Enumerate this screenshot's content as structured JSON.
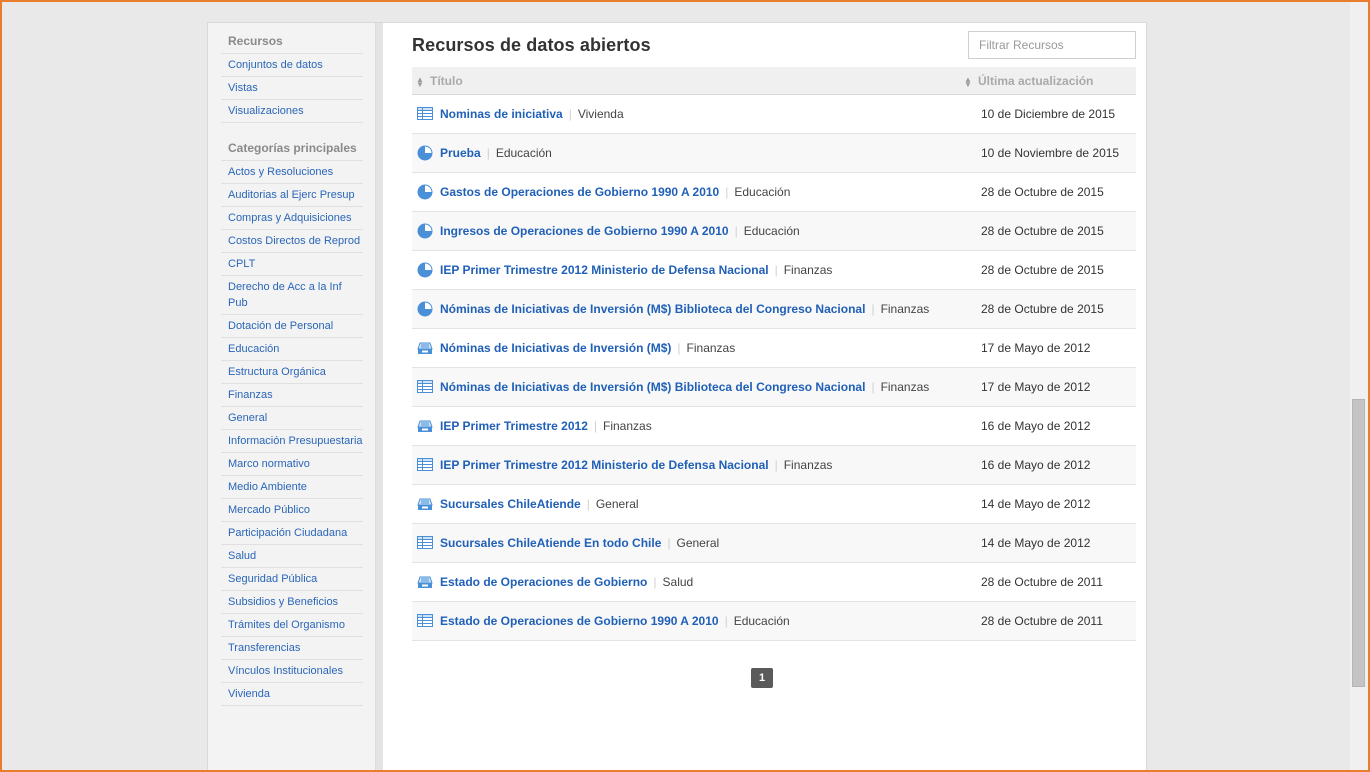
{
  "sidebar": {
    "resources_heading": "Recursos",
    "resources": [
      "Conjuntos de datos",
      "Vistas",
      "Visualizaciones"
    ],
    "categories_heading": "Categorías principales",
    "categories": [
      "Actos y Resoluciones",
      "Auditorias al Ejerc Presup",
      "Compras y Adquisiciones",
      "Costos Directos de Reprod",
      "CPLT",
      "Derecho de Acc a la Inf Pub",
      "Dotación de Personal",
      "Educación",
      "Estructura Orgánica",
      "Finanzas",
      "General",
      "Información Presupuestaria",
      "Marco normativo",
      "Medio Ambiente",
      "Mercado Público",
      "Participación Ciudadana",
      "Salud",
      "Seguridad Pública",
      "Subsidios y Beneficios",
      "Trámites del Organismo",
      "Transferencias",
      "Vínculos Institucionales",
      "Vivienda"
    ]
  },
  "main": {
    "title": "Recursos de datos abiertos",
    "filter_placeholder": "Filtrar Recursos",
    "col_title": "Título",
    "col_date": "Última actualización",
    "page": "1"
  },
  "rows": [
    {
      "icon": "table-icon",
      "name": "Nominas de iniciativa",
      "category": "Vivienda",
      "date": "10 de Diciembre de 2015"
    },
    {
      "icon": "pie-chart-icon",
      "name": "Prueba",
      "category": "Educación",
      "date": "10 de Noviembre de 2015"
    },
    {
      "icon": "pie-chart-icon",
      "name": "Gastos de Operaciones de Gobierno 1990 A 2010",
      "category": "Educación",
      "date": "28 de Octubre de 2015"
    },
    {
      "icon": "pie-chart-icon",
      "name": "Ingresos de Operaciones de Gobierno 1990 A 2010",
      "category": "Educación",
      "date": "28 de Octubre de 2015"
    },
    {
      "icon": "pie-chart-icon",
      "name": "IEP Primer Trimestre 2012 Ministerio de Defensa Nacional",
      "category": "Finanzas",
      "date": "28 de Octubre de 2015"
    },
    {
      "icon": "pie-chart-icon",
      "name": "Nóminas de Iniciativas de Inversión (M$) Biblioteca del Congreso Nacional",
      "category": "Finanzas",
      "date": "28 de Octubre de 2015"
    },
    {
      "icon": "dataset-icon",
      "name": "Nóminas de Iniciativas de Inversión (M$)",
      "category": "Finanzas",
      "date": "17 de Mayo de 2012"
    },
    {
      "icon": "table-icon",
      "name": "Nóminas de Iniciativas de Inversión (M$) Biblioteca del Congreso Nacional",
      "category": "Finanzas",
      "date": "17 de Mayo de 2012"
    },
    {
      "icon": "dataset-icon",
      "name": "IEP Primer Trimestre 2012",
      "category": "Finanzas",
      "date": "16 de Mayo de 2012"
    },
    {
      "icon": "table-icon",
      "name": "IEP Primer Trimestre 2012 Ministerio de Defensa Nacional",
      "category": "Finanzas",
      "date": "16 de Mayo de 2012"
    },
    {
      "icon": "dataset-icon",
      "name": "Sucursales ChileAtiende",
      "category": "General",
      "date": "14 de Mayo de 2012"
    },
    {
      "icon": "table-icon",
      "name": "Sucursales ChileAtiende En todo Chile",
      "category": "General",
      "date": "14 de Mayo de 2012"
    },
    {
      "icon": "dataset-icon",
      "name": "Estado de Operaciones de Gobierno",
      "category": "Salud",
      "date": "28 de Octubre de 2011"
    },
    {
      "icon": "table-icon",
      "name": "Estado de Operaciones de Gobierno 1990 A 2010",
      "category": "Educación",
      "date": "28 de Octubre de 2011"
    }
  ]
}
